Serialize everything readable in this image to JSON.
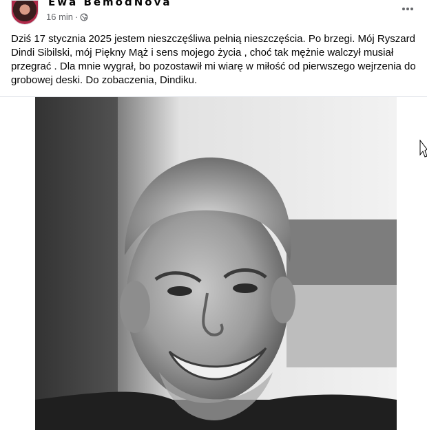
{
  "post": {
    "author": "Ewa BemodNova",
    "time": "16 min",
    "separator": "·",
    "privacy_icon": "globe-icon",
    "more_icon": "more-horizontal-icon",
    "text": "Dziś 17 stycznia 2025 jestem nieszczęśliwa pełnią nieszczęścia. Po brzegi. Mój Ryszard Dindi Sibilski, mój Piękny Mąż  i  sens mojego życia , choć tak mężnie walczył musiał przegrać . Dla mnie wygrał,  bo pozostawił mi wiarę w miłość od pierwszego wejrzenia do grobowej deski. Do zobaczenia, Dindiku.",
    "photo": {
      "description_type": "black-and-white portrait photo",
      "style": "grayscale"
    }
  },
  "colors": {
    "text_primary": "#050505",
    "text_secondary": "#65676b",
    "divider": "#e4e6eb",
    "avatar_ring": "#b02a4a"
  }
}
